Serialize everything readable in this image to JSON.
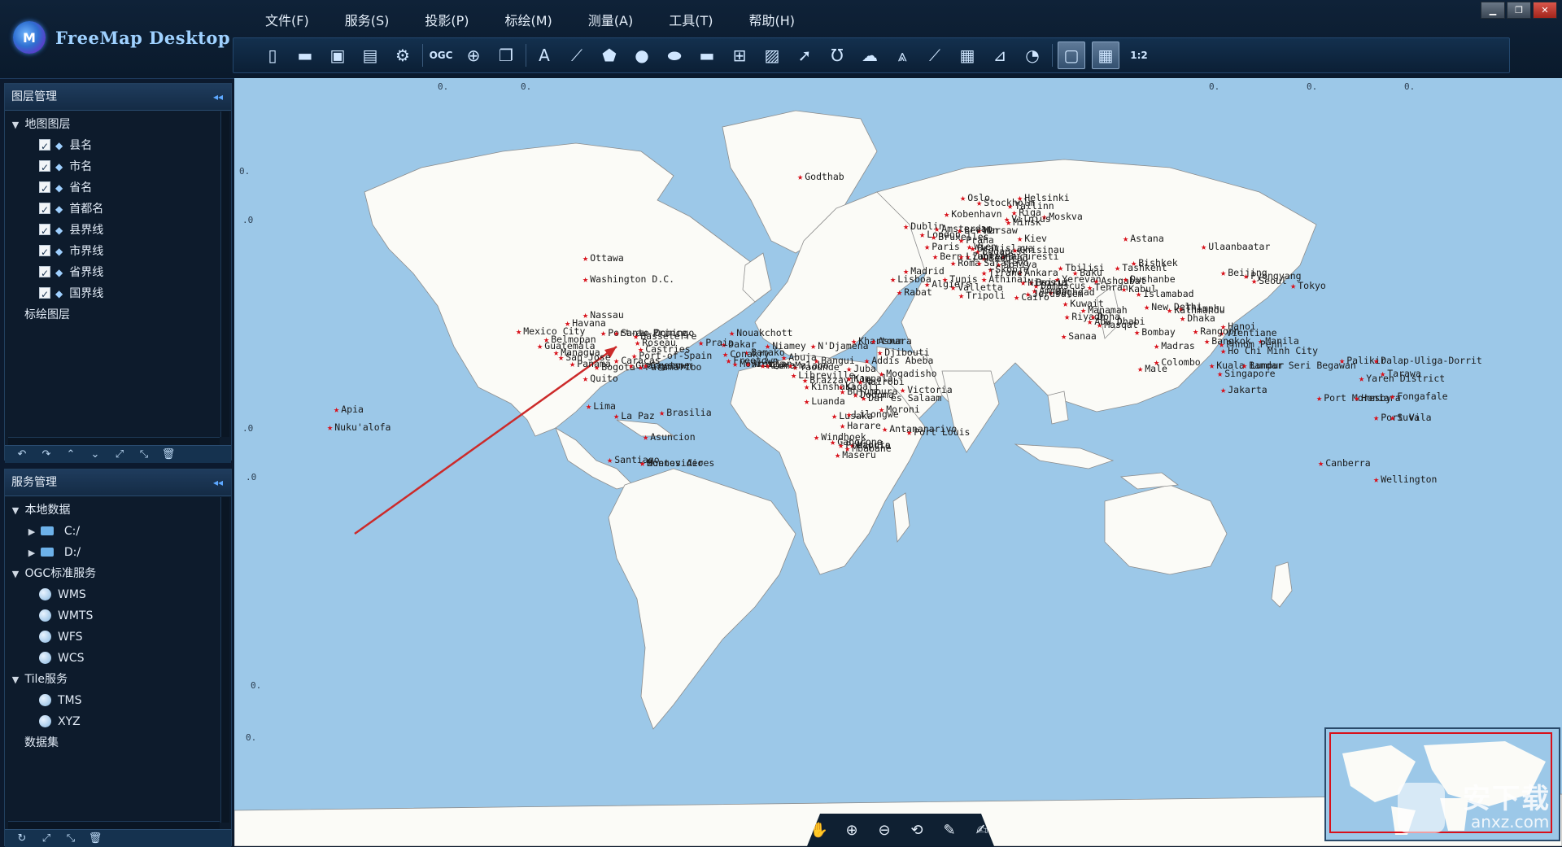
{
  "app": {
    "title": "FreeMap Desktop",
    "logo_letter": "M"
  },
  "menu": [
    "文件(F)",
    "服务(S)",
    "投影(P)",
    "标绘(M)",
    "测量(A)",
    "工具(T)",
    "帮助(H)"
  ],
  "window_controls": [
    "minimize",
    "restore",
    "close"
  ],
  "toolbar": [
    {
      "name": "new-file-icon",
      "glyph": "▯"
    },
    {
      "name": "open-folder-icon",
      "glyph": "▬"
    },
    {
      "name": "save-icon",
      "glyph": "▣"
    },
    {
      "name": "save-as-icon",
      "glyph": "▤"
    },
    {
      "name": "settings-gear-icon",
      "glyph": "⚙"
    },
    {
      "name": "ogc-icon",
      "glyph": "OGC",
      "small": true
    },
    {
      "name": "globe-icon",
      "glyph": "⊕"
    },
    {
      "name": "layers-icon",
      "glyph": "❐"
    },
    {
      "name": "text-icon",
      "glyph": "A"
    },
    {
      "name": "polyline-icon",
      "glyph": "⟋"
    },
    {
      "name": "polygon-icon",
      "glyph": "⬟"
    },
    {
      "name": "circle-icon",
      "glyph": "●"
    },
    {
      "name": "ellipse-icon",
      "glyph": "⬬"
    },
    {
      "name": "rectangle-icon",
      "glyph": "▬"
    },
    {
      "name": "crosshair-icon",
      "glyph": "⊞"
    },
    {
      "name": "image-icon",
      "glyph": "▨"
    },
    {
      "name": "arrow-icon",
      "glyph": "➚"
    },
    {
      "name": "u-arrow-icon",
      "glyph": "Ʊ"
    },
    {
      "name": "cloud-icon",
      "glyph": "☁"
    },
    {
      "name": "attack-arrow-icon",
      "glyph": "⩓"
    },
    {
      "name": "measure-distance-icon",
      "glyph": "⟋"
    },
    {
      "name": "measure-area-icon",
      "glyph": "▦"
    },
    {
      "name": "measure-angle-icon",
      "glyph": "⊿"
    },
    {
      "name": "compass-icon",
      "glyph": "◔"
    },
    {
      "name": "overview-toggle-icon",
      "glyph": "▢",
      "active": true
    },
    {
      "name": "grid-toggle-icon",
      "glyph": "▦",
      "active": true
    },
    {
      "name": "scale-ratio-icon",
      "glyph": "1:2",
      "small": true
    }
  ],
  "layer_panel": {
    "title": "图层管理",
    "root": "地图图层",
    "layers": [
      "县名",
      "市名",
      "省名",
      "首都名",
      "县界线",
      "市界线",
      "省界线",
      "国界线"
    ],
    "plot_group": "标绘图层"
  },
  "layer_buttons": [
    "↶",
    "↷",
    "⌃",
    "⌄",
    "⤢",
    "⤡",
    "🗑"
  ],
  "service_panel": {
    "title": "服务管理",
    "local": {
      "label": "本地数据",
      "children": [
        "C:/",
        "D:/"
      ]
    },
    "ogc": {
      "label": "OGC标准服务",
      "children": [
        "WMS",
        "WMTS",
        "WFS",
        "WCS"
      ]
    },
    "tile": {
      "label": "Tile服务",
      "children": [
        "TMS",
        "XYZ"
      ]
    },
    "dataset": "数据集"
  },
  "service_buttons": [
    "↻",
    "⤢",
    "⤡",
    "🗑"
  ],
  "map_tools": [
    "✋",
    "⊕",
    "⊖",
    "⟲",
    "✎",
    "✍"
  ],
  "grid_labels": {
    "top": "0.",
    "side": "0.",
    "side2": ".0"
  },
  "cities": [
    "Godthab",
    "Oslo",
    "Helsinki",
    "Riga",
    "Moskva",
    "Kobenhavn",
    "Minsk",
    "Warsaw",
    "Kiev",
    "Dublin",
    "London",
    "Paris",
    "Bern",
    "Bucuresti",
    "Madrid",
    "Lisboa",
    "Rabat",
    "Algiers",
    "Tunis",
    "Tripoli",
    "Athinai",
    "Ankara",
    "Tbilisi",
    "Baku",
    "Yerevan",
    "Tashkent",
    "Bishkek",
    "Astana",
    "Ulaanbaatar",
    "Beijing",
    "Pyongyang",
    "Seoul",
    "Tokyo",
    "Ashgabat",
    "Dushanbe",
    "Tehran",
    "Kabul",
    "Islamabad",
    "Baghdad",
    "Kuwait",
    "Manamah",
    "Riyadh",
    "Doha",
    "Masqat",
    "New Delhi",
    "Thimphu",
    "Dhaka",
    "Hanoi",
    "Vientiane",
    "Bombay",
    "Madras",
    "Bangkok",
    "Manila",
    "Ho Chi Minh City",
    "Colombo",
    "Kuala Lumpur",
    "Singapore",
    "Bandar Seri Begawan",
    "Jakarta",
    "Palikir",
    "Dalap-Uliga-Dorrit",
    "Tarawa",
    "Yaren District",
    "Port Moresby",
    "Honiara",
    "Fongafale",
    "Port Vila",
    "Suva",
    "Canberra",
    "Wellington",
    "Ottawa",
    "Washington D.C.",
    "Nassau",
    "Havana",
    "Mexico City",
    "Belmopan",
    "Guatemala",
    "Managua",
    "San Jose",
    "Panama",
    "Port-au-Prince",
    "Santo Domingo",
    "Basseterre",
    "Roseau",
    "Castries",
    "Port-of-Spain",
    "Bogota",
    "Caracas",
    "Georgetown",
    "Paramaribo",
    "Cayenne",
    "Quito",
    "Lima",
    "La Paz",
    "Brasilia",
    "Asuncion",
    "Santiago",
    "Buenos Aires",
    "Montevideo",
    "Apia",
    "Nuku'alofa",
    "Nouakchott",
    "Dakar",
    "Praia",
    "Bamako",
    "Niamey",
    "Conakry",
    "Freetown",
    "Monrovia",
    "Abidjan",
    "Accra",
    "Lome",
    "Abuja",
    "Yaounde",
    "Malabo",
    "Libreville",
    "Brazzaville",
    "Kinshasa",
    "Bangui",
    "N'Djamena",
    "Khartoum",
    "Asmara",
    "Djibouti",
    "Addis Abeba",
    "Juba",
    "Kampala",
    "Nairobi",
    "Kigali",
    "Bujumbura",
    "Mogadisho",
    "Dodoma",
    "Dar es Salaam",
    "Victoria",
    "Moroni",
    "Luanda",
    "Lusaka",
    "Lilongwe",
    "Harare",
    "Antananarivo",
    "Port Louis",
    "Windhoek",
    "Gaborone",
    "Pretoria",
    "Maseru",
    "Maputo",
    "Mbabane",
    "Cairo",
    "Damascus",
    "Beirut",
    "Amman",
    "Jerusalem",
    "Nicosia",
    "Valletta",
    "Roma",
    "Wien",
    "Praha",
    "Berlin",
    "Amsterdam",
    "Bruxelles",
    "Stockholm",
    "Vilnius",
    "Tallinn",
    "Budapest",
    "Beograd",
    "Sofiya",
    "Skopje",
    "Tirane",
    "Zagreb",
    "Ljubljana",
    "Sarajevo",
    "Bratislava",
    "Chisinau",
    "Sanaa",
    "Abu Dhabi",
    "Kathmandu",
    "Rangoon",
    "Phnom Penh",
    "Male"
  ],
  "watermark": {
    "main": "安下载",
    "sub": "anxz.com"
  },
  "colors": {
    "ocean": "#9cc8e8",
    "land": "#fbfbf7",
    "city_star": "#d8101a",
    "panel_bg": "#0d1b2c",
    "accent": "#5da8ff",
    "arrow": "#cc2a2a"
  }
}
